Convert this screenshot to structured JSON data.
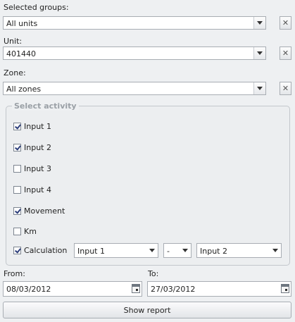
{
  "filters": {
    "groups": {
      "label": "Selected groups:",
      "value": "All units"
    },
    "unit": {
      "label": "Unit:",
      "value": "401440"
    },
    "zone": {
      "label": "Zone:",
      "value": "All zones"
    }
  },
  "activity": {
    "title": "Select activity",
    "items": [
      {
        "label": "Input 1",
        "checked": true
      },
      {
        "label": "Input 2",
        "checked": true
      },
      {
        "label": "Input 3",
        "checked": false
      },
      {
        "label": "Input 4",
        "checked": false
      },
      {
        "label": "Movement",
        "checked": true
      },
      {
        "label": "Km",
        "checked": false
      }
    ],
    "calculation": {
      "label": "Calculation",
      "checked": true,
      "operand1": "Input 1",
      "operator": "-",
      "operand2": "Input 2"
    }
  },
  "dates": {
    "from": {
      "label": "From:",
      "value": "08/03/2012"
    },
    "to": {
      "label": "To:",
      "value": "27/03/2012"
    }
  },
  "actions": {
    "show_report": "Show report"
  }
}
